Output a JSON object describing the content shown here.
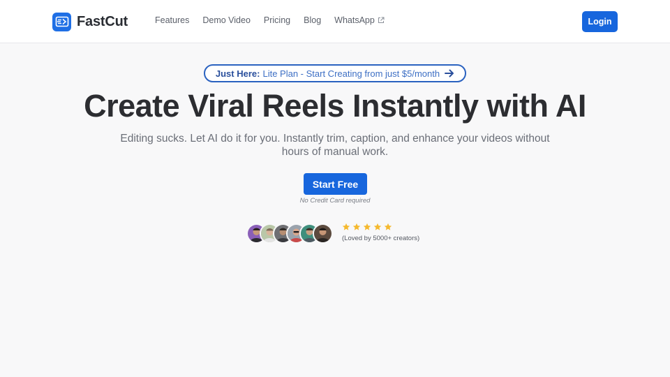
{
  "header": {
    "brand_name": "FastCut",
    "nav": [
      {
        "label": "Features"
      },
      {
        "label": "Demo Video"
      },
      {
        "label": "Pricing"
      },
      {
        "label": "Blog"
      },
      {
        "label": "WhatsApp",
        "icon": "external-link-icon"
      }
    ],
    "login_label": "Login"
  },
  "announcement": {
    "strong": "Just Here:",
    "text": "Lite Plan - Start Creating from just $5/month",
    "icon": "arrow-right-icon"
  },
  "hero": {
    "title": "Create Viral Reels Instantly with AI",
    "subtitle": "Editing sucks. Let AI do it for you. Instantly trim, caption, and enhance your videos without hours of manual work.",
    "cta_label": "Start Free",
    "cta_note": "No Credit Card required"
  },
  "social_proof": {
    "avatar_count": 6,
    "rating_stars": 5,
    "loved_text": "(Loved by 5000+ creators)"
  },
  "colors": {
    "primary": "#1766dd",
    "star": "#f5b92e",
    "background": "#f8f8f9"
  }
}
